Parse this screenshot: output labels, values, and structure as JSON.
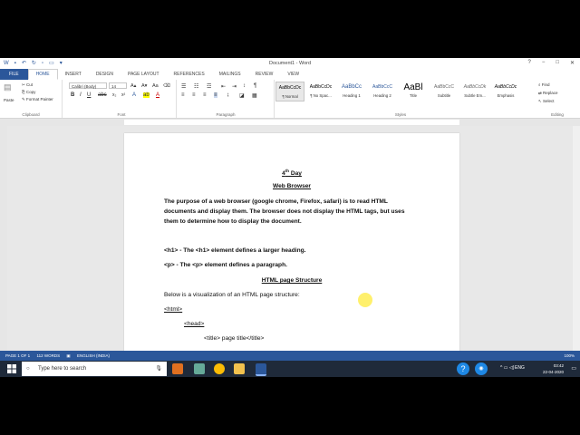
{
  "window": {
    "title": "Document1 - Word",
    "controls": [
      "?",
      "−",
      "□",
      "✕"
    ]
  },
  "tabs": [
    "FILE",
    "HOME",
    "INSERT",
    "DESIGN",
    "PAGE LAYOUT",
    "REFERENCES",
    "MAILINGS",
    "REVIEW",
    "VIEW"
  ],
  "ribbon": {
    "clipboard": {
      "paste": "Paste",
      "cut": "Cut",
      "copy": "Copy",
      "format_painter": "Format Painter",
      "label": "Clipboard"
    },
    "font": {
      "name": "Calibri (Body)",
      "size": "14",
      "label": "Font"
    },
    "paragraph": {
      "label": "Paragraph"
    },
    "styles": {
      "label": "Styles",
      "items": [
        {
          "preview": "AaBbCcDc",
          "name": "¶ Normal"
        },
        {
          "preview": "AaBbCcDc",
          "name": "¶ No Spac..."
        },
        {
          "preview": "AaBbCc",
          "name": "Heading 1"
        },
        {
          "preview": "AaBbCcC",
          "name": "Heading 2"
        },
        {
          "preview": "AaBl",
          "name": "Title"
        },
        {
          "preview": "AaBbCcC",
          "name": "Subtitle"
        },
        {
          "preview": "AaBbCcDk",
          "name": "Subtle Em..."
        },
        {
          "preview": "AaBbCcDc",
          "name": "Emphasis"
        }
      ]
    },
    "editing": {
      "find": "Find",
      "replace": "Replace",
      "select": "Select",
      "label": "Editing"
    }
  },
  "document": {
    "day_sup": "th",
    "day_num": "4",
    "day_word": " Day",
    "web_browser": "Web Browser",
    "para1": "The purpose of a web browser (google chrome, Firefox, safari) is to read HTML documents and display them. The browser does not display the HTML tags, but uses them to determine how to display the document.",
    "h1_line": "<h1> - The <h1> element defines a larger heading.",
    "p_line": "<p> -   The <p> element defines a paragraph.",
    "structure_title": "HTML page Structure",
    "structure_intro": "Below is a visualization of an HTML page structure:",
    "html_tag": "<html>",
    "head_tag": "<head>",
    "title_line": "<title> page title</title>"
  },
  "status": {
    "page": "PAGE 1 OF 1",
    "words": "112 WORDS",
    "language": "ENGLISH (INDIA)",
    "zoom": "100%"
  },
  "taskbar": {
    "search_placeholder": "Type here to search",
    "time": "03:42",
    "date": "22-04-2020",
    "lang": "ENG"
  }
}
